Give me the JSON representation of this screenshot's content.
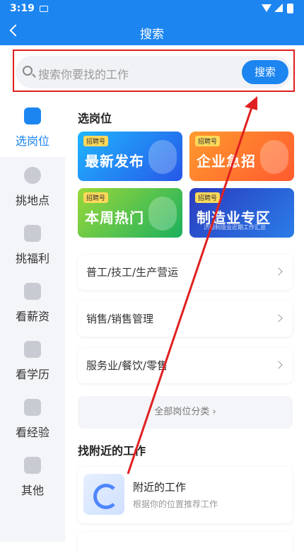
{
  "status_bar": {
    "time": "3:19"
  },
  "header": {
    "title": "搜索"
  },
  "search": {
    "placeholder": "搜索你要找的工作",
    "button_label": "搜索"
  },
  "sidebar": {
    "items": [
      {
        "label": "选岗位",
        "icon": "briefcase-icon",
        "active": true
      },
      {
        "label": "挑地点",
        "icon": "location-pin-icon",
        "active": false
      },
      {
        "label": "挑福利",
        "icon": "gift-icon",
        "active": false
      },
      {
        "label": "看薪资",
        "icon": "yen-icon",
        "active": false
      },
      {
        "label": "看学历",
        "icon": "graduation-cap-icon",
        "active": false
      },
      {
        "label": "看经验",
        "icon": "toolbox-icon",
        "active": false
      },
      {
        "label": "其他",
        "icon": "bag-icon",
        "active": false
      }
    ]
  },
  "main": {
    "section_jobs_title": "选岗位",
    "banners": [
      {
        "tag": "招聘号",
        "text": "最新发布"
      },
      {
        "tag": "招聘号",
        "text": "企业急招"
      },
      {
        "tag": "招聘号",
        "text": "本周热门"
      },
      {
        "tag": "招聘号",
        "text": "制造业专区",
        "sub": "济阳制造业近期工作汇总"
      }
    ],
    "categories": [
      {
        "label": "普工/技工/生产营运"
      },
      {
        "label": "销售/销售管理"
      },
      {
        "label": "服务业/餐饮/零售"
      }
    ],
    "all_categories_label": "全部岗位分类 ›",
    "section_nearby_title": "找附近的工作",
    "nearby": {
      "title": "附近的工作",
      "subtitle": "根据你的位置推荐工作"
    }
  },
  "colors": {
    "accent": "#1c85f0",
    "annotation": "#e02020"
  }
}
